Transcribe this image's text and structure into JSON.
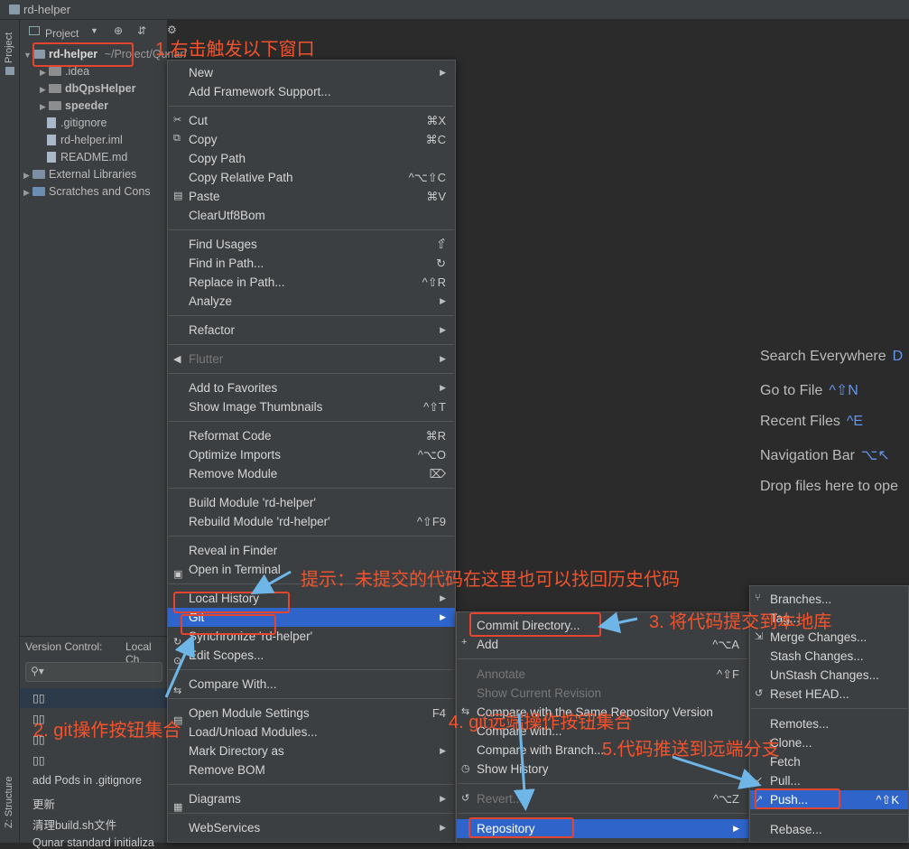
{
  "window": {
    "title": "rd-helper"
  },
  "left_tool": {
    "project_tab": "Project",
    "structure_tab": "Z: Structure"
  },
  "project_panel": {
    "header": "Project",
    "root": {
      "name": "rd-helper",
      "path": "~/Project/Qunar/"
    },
    "items": [
      {
        "label": ".idea",
        "type": "folder"
      },
      {
        "label": "dbQpsHelper",
        "type": "folder"
      },
      {
        "label": "speeder",
        "type": "folder"
      },
      {
        "label": ".gitignore",
        "type": "file"
      },
      {
        "label": "rd-helper.iml",
        "type": "file"
      },
      {
        "label": "README.md",
        "type": "file"
      },
      {
        "label": "External Libraries",
        "type": "lib"
      },
      {
        "label": "Scratches and Cons",
        "type": "scratch"
      }
    ]
  },
  "version_control": {
    "title": "Version Control:",
    "tab": "Local Ch",
    "rows": [
      "▯▯",
      "▯▯",
      "▯▯",
      "▯▯",
      "add Pods in .gitignore",
      "更新",
      "清理build.sh文件",
      "Qunar standard initializa"
    ]
  },
  "context_menu": {
    "groups": [
      [
        {
          "label": "New",
          "sub": true
        },
        {
          "label": "Add Framework Support..."
        }
      ],
      [
        {
          "label": "Cut",
          "shortcut": "⌘X",
          "icon": "✂"
        },
        {
          "label": "Copy",
          "shortcut": "⌘C",
          "icon": "⧉"
        },
        {
          "label": "Copy Path"
        },
        {
          "label": "Copy Relative Path",
          "shortcut": "^⌥⇧C"
        },
        {
          "label": "Paste",
          "shortcut": "⌘V",
          "icon": "▤"
        },
        {
          "label": "ClearUtf8Bom"
        }
      ],
      [
        {
          "label": "Find Usages",
          "shortcut": "⇧̂"
        },
        {
          "label": "Find in Path...",
          "shortcut": "↻"
        },
        {
          "label": "Replace in Path...",
          "shortcut": "^⇧R"
        },
        {
          "label": "Analyze",
          "sub": true
        }
      ],
      [
        {
          "label": "Refactor",
          "sub": true
        }
      ],
      [
        {
          "label": "Flutter",
          "sub": true,
          "disabled": true
        }
      ],
      [
        {
          "label": "Add to Favorites",
          "sub": true
        },
        {
          "label": "Show Image Thumbnails",
          "shortcut": "^⇧T"
        }
      ],
      [
        {
          "label": "Reformat Code",
          "shortcut": "⌘R"
        },
        {
          "label": "Optimize Imports",
          "shortcut": "^⌥O"
        },
        {
          "label": "Remove Module",
          "shortcut": "⌦"
        }
      ],
      [
        {
          "label": "Build Module 'rd-helper'"
        },
        {
          "label": "Rebuild Module 'rd-helper'",
          "shortcut": "^⇧F9"
        }
      ],
      [
        {
          "label": "Reveal in Finder"
        },
        {
          "label": "Open in Terminal"
        }
      ],
      [
        {
          "label": "Local History",
          "sub": true
        },
        {
          "label": "Git",
          "sub": true,
          "selected": true
        },
        {
          "label": "Synchronize 'rd-helper'"
        },
        {
          "label": "Edit Scopes..."
        }
      ],
      [
        {
          "label": "Compare With..."
        }
      ],
      [
        {
          "label": "Open Module Settings",
          "shortcut": "F4"
        },
        {
          "label": "Load/Unload Modules..."
        },
        {
          "label": "Mark Directory as",
          "sub": true
        },
        {
          "label": "Remove BOM"
        }
      ],
      [
        {
          "label": "Diagrams",
          "sub": true
        }
      ],
      [
        {
          "label": "WebServices",
          "sub": true
        }
      ]
    ]
  },
  "git_menu": {
    "items": [
      {
        "label": "Commit Directory..."
      },
      {
        "label": "Add",
        "shortcut": "^⌥A"
      },
      {
        "label": "Annotate",
        "shortcut": "^⇧F",
        "disabled": true
      },
      {
        "label": "Show Current Revision",
        "disabled": true
      },
      {
        "label": "Compare with the Same Repository Version"
      },
      {
        "label": "Compare with..."
      },
      {
        "label": "Compare with Branch..."
      },
      {
        "label": "Show History"
      },
      {
        "label": "Revert...",
        "shortcut": "^⌥Z",
        "disabled": true
      },
      {
        "label": "Repository",
        "sub": true,
        "selected": true
      }
    ]
  },
  "repo_menu": {
    "items": [
      {
        "label": "Branches..."
      },
      {
        "label": "Tag..."
      },
      {
        "label": "Merge Changes..."
      },
      {
        "label": "Stash Changes..."
      },
      {
        "label": "UnStash Changes..."
      },
      {
        "label": "Reset HEAD..."
      },
      {
        "label": "Remotes..."
      },
      {
        "label": "Clone..."
      },
      {
        "label": "Fetch"
      },
      {
        "label": "Pull..."
      },
      {
        "label": "Push...",
        "shortcut": "^⇧K",
        "selected": true
      },
      {
        "label": "Rebase..."
      }
    ]
  },
  "editor_hints": [
    {
      "label": "Search Everywhere",
      "key": "D"
    },
    {
      "label": "Go to File",
      "key": "^⇧N"
    },
    {
      "label": "Recent Files",
      "key": "^E"
    },
    {
      "label": "Navigation Bar",
      "key": "⌥↖"
    },
    {
      "label": "Drop files here to ope",
      "key": ""
    }
  ],
  "annotations": {
    "step1": "1.右击触发以下窗口",
    "step2": "2. git操作按钮集合",
    "step3": "3. 将代码提交到本地库",
    "step4": "4. git远端操作按钮集合",
    "step5": "5.代码推送到远端分支",
    "tip": "提示：未提交的代码在这里也可以找回历史代码"
  },
  "colors": {
    "selection": "#2f65ca",
    "annotation": "#f3532c",
    "arrow": "#6fb6e8",
    "hint_key": "#6495ed"
  }
}
